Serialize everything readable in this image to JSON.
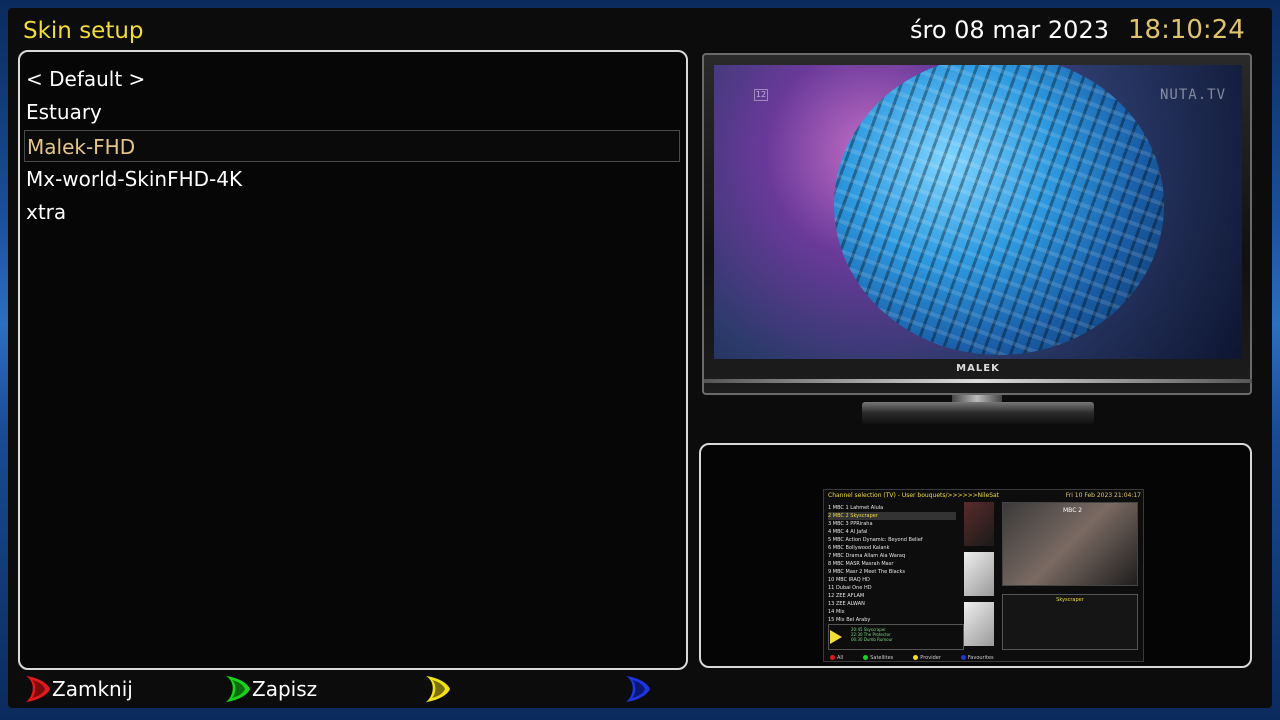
{
  "header": {
    "title": "Skin setup",
    "date": "śro 08 mar 2023",
    "time": "18:10:24"
  },
  "skins": {
    "items": [
      {
        "label": "< Default >"
      },
      {
        "label": "Estuary"
      },
      {
        "label": "Malek-FHD"
      },
      {
        "label": "Mx-world-SkinFHD-4K"
      },
      {
        "label": "xtra"
      }
    ],
    "selected_label": "Malek-FHD"
  },
  "tv_preview": {
    "brand": "MALEK",
    "channel_logo": "NUTA.TV",
    "corner_badge": "12"
  },
  "skin_preview": {
    "header_left": "Channel selection (TV) - User bouquets/>>>>>>NileSat",
    "header_right": "Fri 10 Feb 2023   21:04:17",
    "channels": [
      "1  MBC 1  Lahmet Alula",
      "2  MBC 2  Skyscraper",
      "3  MBC 3  PPRiraha",
      "4  MBC 4  Al Jafal",
      "5  MBC Action  Dynamic: Beyond Belief",
      "6  MBC Bollywood  Kalank",
      "7  MBC Drama  Allam Ala Waraq",
      "8  MBC MASR  Masrah Masr",
      "9  MBC Masr 2  Meet The Blacks",
      "10  MBC IRAQ HD",
      "11  Dubai One HD",
      "12  ZEE AFLAM",
      "13  ZEE ALWAN",
      "14  Mix",
      "15  Mix Bel Araby"
    ],
    "selected_channel": "2  MBC 2  Skyscraper",
    "tv_title": "MBC 2",
    "epg_title": "Skyscraper",
    "info_lines": [
      "20:45  Skyscraper",
      "22:30  The Protector",
      "00:30  Dumb Rumour"
    ],
    "footer": [
      "All",
      "Satellites",
      "Provider",
      "Favourites"
    ]
  },
  "footer": {
    "red_label": "Zamknij",
    "green_label": "Zapisz",
    "yellow_label": "",
    "blue_label": ""
  },
  "colors": {
    "title": "#f2dc3a",
    "time": "#e0c46c",
    "selected_item": "#e6c58a",
    "red": "#e0191c",
    "green": "#19d41c",
    "yellow": "#f2e019",
    "blue": "#1c35e0"
  },
  "icons": {
    "red": "red-button-icon",
    "green": "green-button-icon",
    "yellow": "yellow-button-icon",
    "blue": "blue-button-icon"
  }
}
